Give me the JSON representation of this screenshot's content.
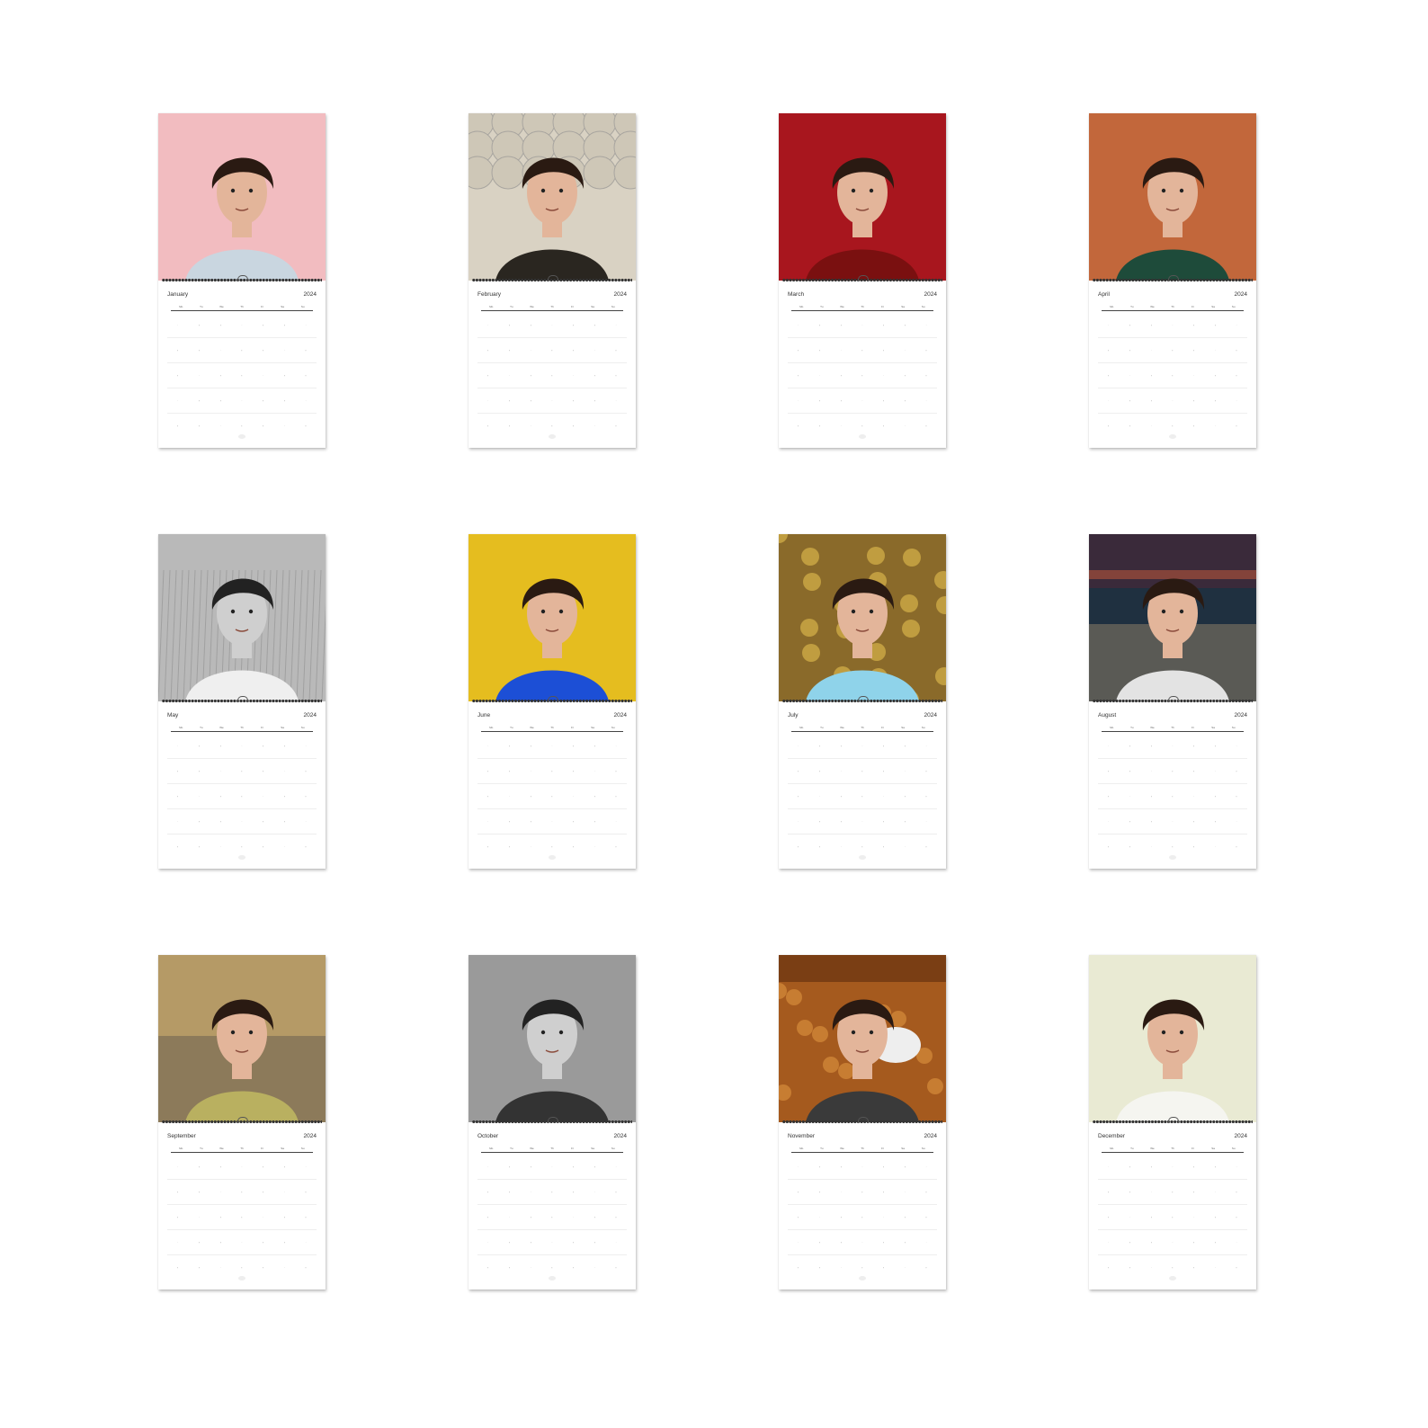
{
  "year": "2024",
  "weekdays": [
    "Mo",
    "Tu",
    "We",
    "Th",
    "Fr",
    "Sa",
    "Su"
  ],
  "calendars": [
    {
      "month": "January",
      "photo": {
        "bg": "#f2bcc0",
        "style": "pink-portrait"
      }
    },
    {
      "month": "February",
      "photo": {
        "bg": "#d9d2c3",
        "style": "scales-backdrop"
      }
    },
    {
      "month": "March",
      "photo": {
        "bg": "#a8161e",
        "style": "red-backdrop"
      }
    },
    {
      "month": "April",
      "photo": {
        "bg": "#c2673b",
        "style": "green-sweater"
      }
    },
    {
      "month": "May",
      "photo": {
        "bg": "#b9b9b9",
        "style": "black-white-field"
      }
    },
    {
      "month": "June",
      "photo": {
        "bg": "#e5bd1f",
        "style": "yellow-backdrop"
      }
    },
    {
      "month": "July",
      "photo": {
        "bg": "#8a6a2a",
        "style": "patterned-shirt"
      }
    },
    {
      "month": "August",
      "photo": {
        "bg": "#1f3040",
        "style": "dusk-wall"
      }
    },
    {
      "month": "September",
      "photo": {
        "bg": "#8c7a5a",
        "style": "seaside-check-coat"
      }
    },
    {
      "month": "October",
      "photo": {
        "bg": "#9a9a9a",
        "style": "black-white-studio"
      }
    },
    {
      "month": "November",
      "photo": {
        "bg": "#7a3e14",
        "style": "ornate-sofa"
      }
    },
    {
      "month": "December",
      "photo": {
        "bg": "#e9ead3",
        "style": "cream-backdrop"
      }
    }
  ]
}
